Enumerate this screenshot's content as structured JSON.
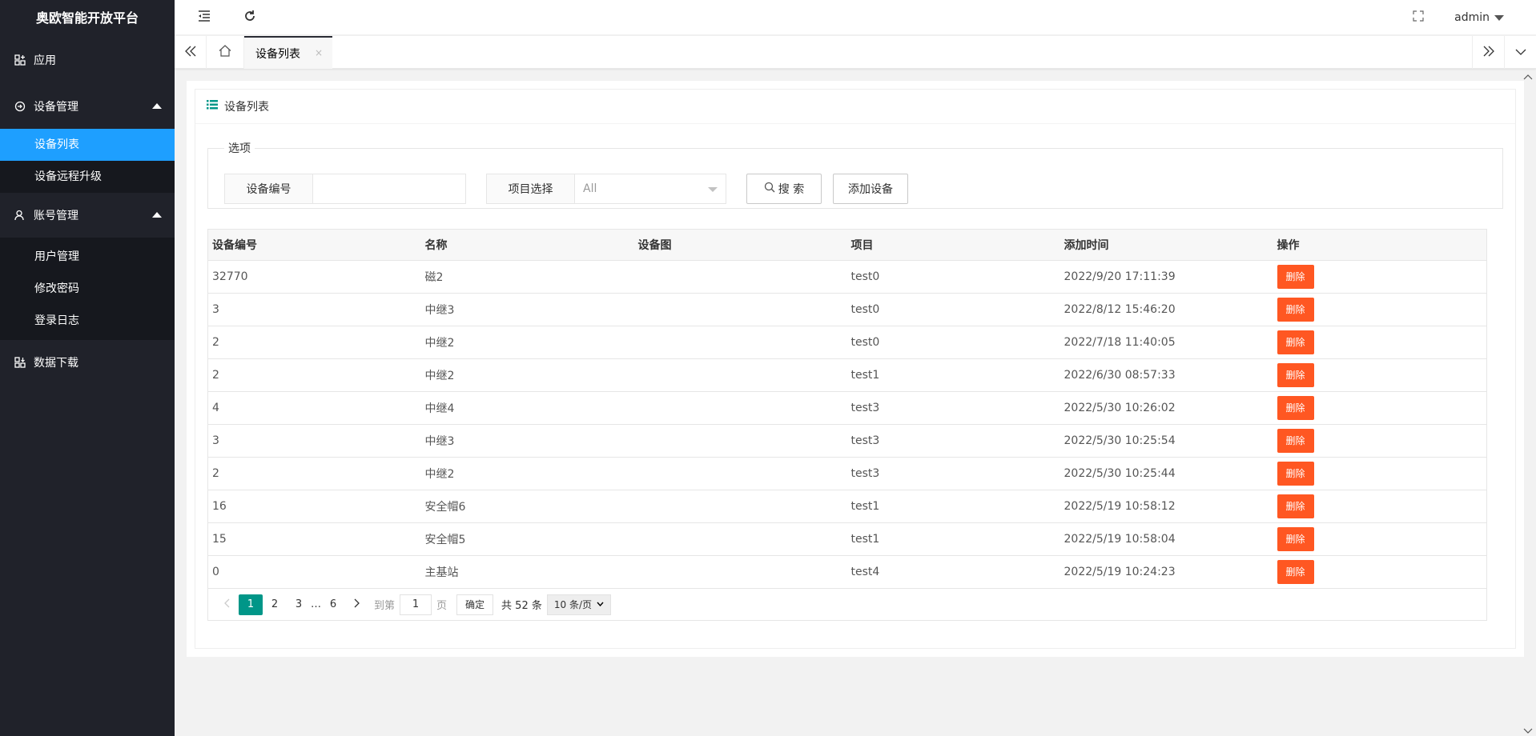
{
  "app_title": "奥欧智能开放平台",
  "sidebar": {
    "items": [
      {
        "label": "应用"
      },
      {
        "label": "设备管理",
        "children": [
          "设备列表",
          "设备远程升级"
        ]
      },
      {
        "label": "账号管理",
        "children": [
          "用户管理",
          "修改密码",
          "登录日志"
        ]
      },
      {
        "label": "数据下载"
      }
    ],
    "active": "设备列表"
  },
  "header": {
    "user": "admin"
  },
  "tabs": [
    {
      "label": "设备列表",
      "close": "×"
    }
  ],
  "card": {
    "title": "设备列表"
  },
  "filters": {
    "legend": "选项",
    "device_no_label": "设备编号",
    "device_no_value": "",
    "project_label": "项目选择",
    "project_value": "All",
    "search_label": "搜 索",
    "add_label": "添加设备"
  },
  "table": {
    "columns": [
      "设备编号",
      "名称",
      "设备图",
      "项目",
      "添加时间",
      "操作"
    ],
    "rows": [
      {
        "id": "32770",
        "name": "磁2",
        "img": "",
        "project": "test0",
        "time": "2022/9/20 17:11:39"
      },
      {
        "id": "3",
        "name": "中继3",
        "img": "",
        "project": "test0",
        "time": "2022/8/12 15:46:20"
      },
      {
        "id": "2",
        "name": "中继2",
        "img": "",
        "project": "test0",
        "time": "2022/7/18 11:40:05"
      },
      {
        "id": "2",
        "name": "中继2",
        "img": "",
        "project": "test1",
        "time": "2022/6/30 08:57:33"
      },
      {
        "id": "4",
        "name": "中继4",
        "img": "",
        "project": "test3",
        "time": "2022/5/30 10:26:02"
      },
      {
        "id": "3",
        "name": "中继3",
        "img": "",
        "project": "test3",
        "time": "2022/5/30 10:25:54"
      },
      {
        "id": "2",
        "name": "中继2",
        "img": "",
        "project": "test3",
        "time": "2022/5/30 10:25:44"
      },
      {
        "id": "16",
        "name": "安全帽6",
        "img": "",
        "project": "test1",
        "time": "2022/5/19 10:58:12"
      },
      {
        "id": "15",
        "name": "安全帽5",
        "img": "",
        "project": "test1",
        "time": "2022/5/19 10:58:04"
      },
      {
        "id": "0",
        "name": "主基站",
        "img": "",
        "project": "test4",
        "time": "2022/5/19 10:24:23"
      }
    ],
    "delete_label": "删除"
  },
  "pager": {
    "pages": [
      "1",
      "2",
      "3",
      "…",
      "6"
    ],
    "current": "1",
    "goto_label": "到第",
    "goto_value": "1",
    "page_unit": "页",
    "confirm_label": "确定",
    "total_label": "共 52 条",
    "page_size": "10 条/页"
  },
  "colors": {
    "sidebar_bg": "#20222a",
    "active": "#1e9fff",
    "danger": "#ff5722",
    "pager_current": "#009688"
  }
}
